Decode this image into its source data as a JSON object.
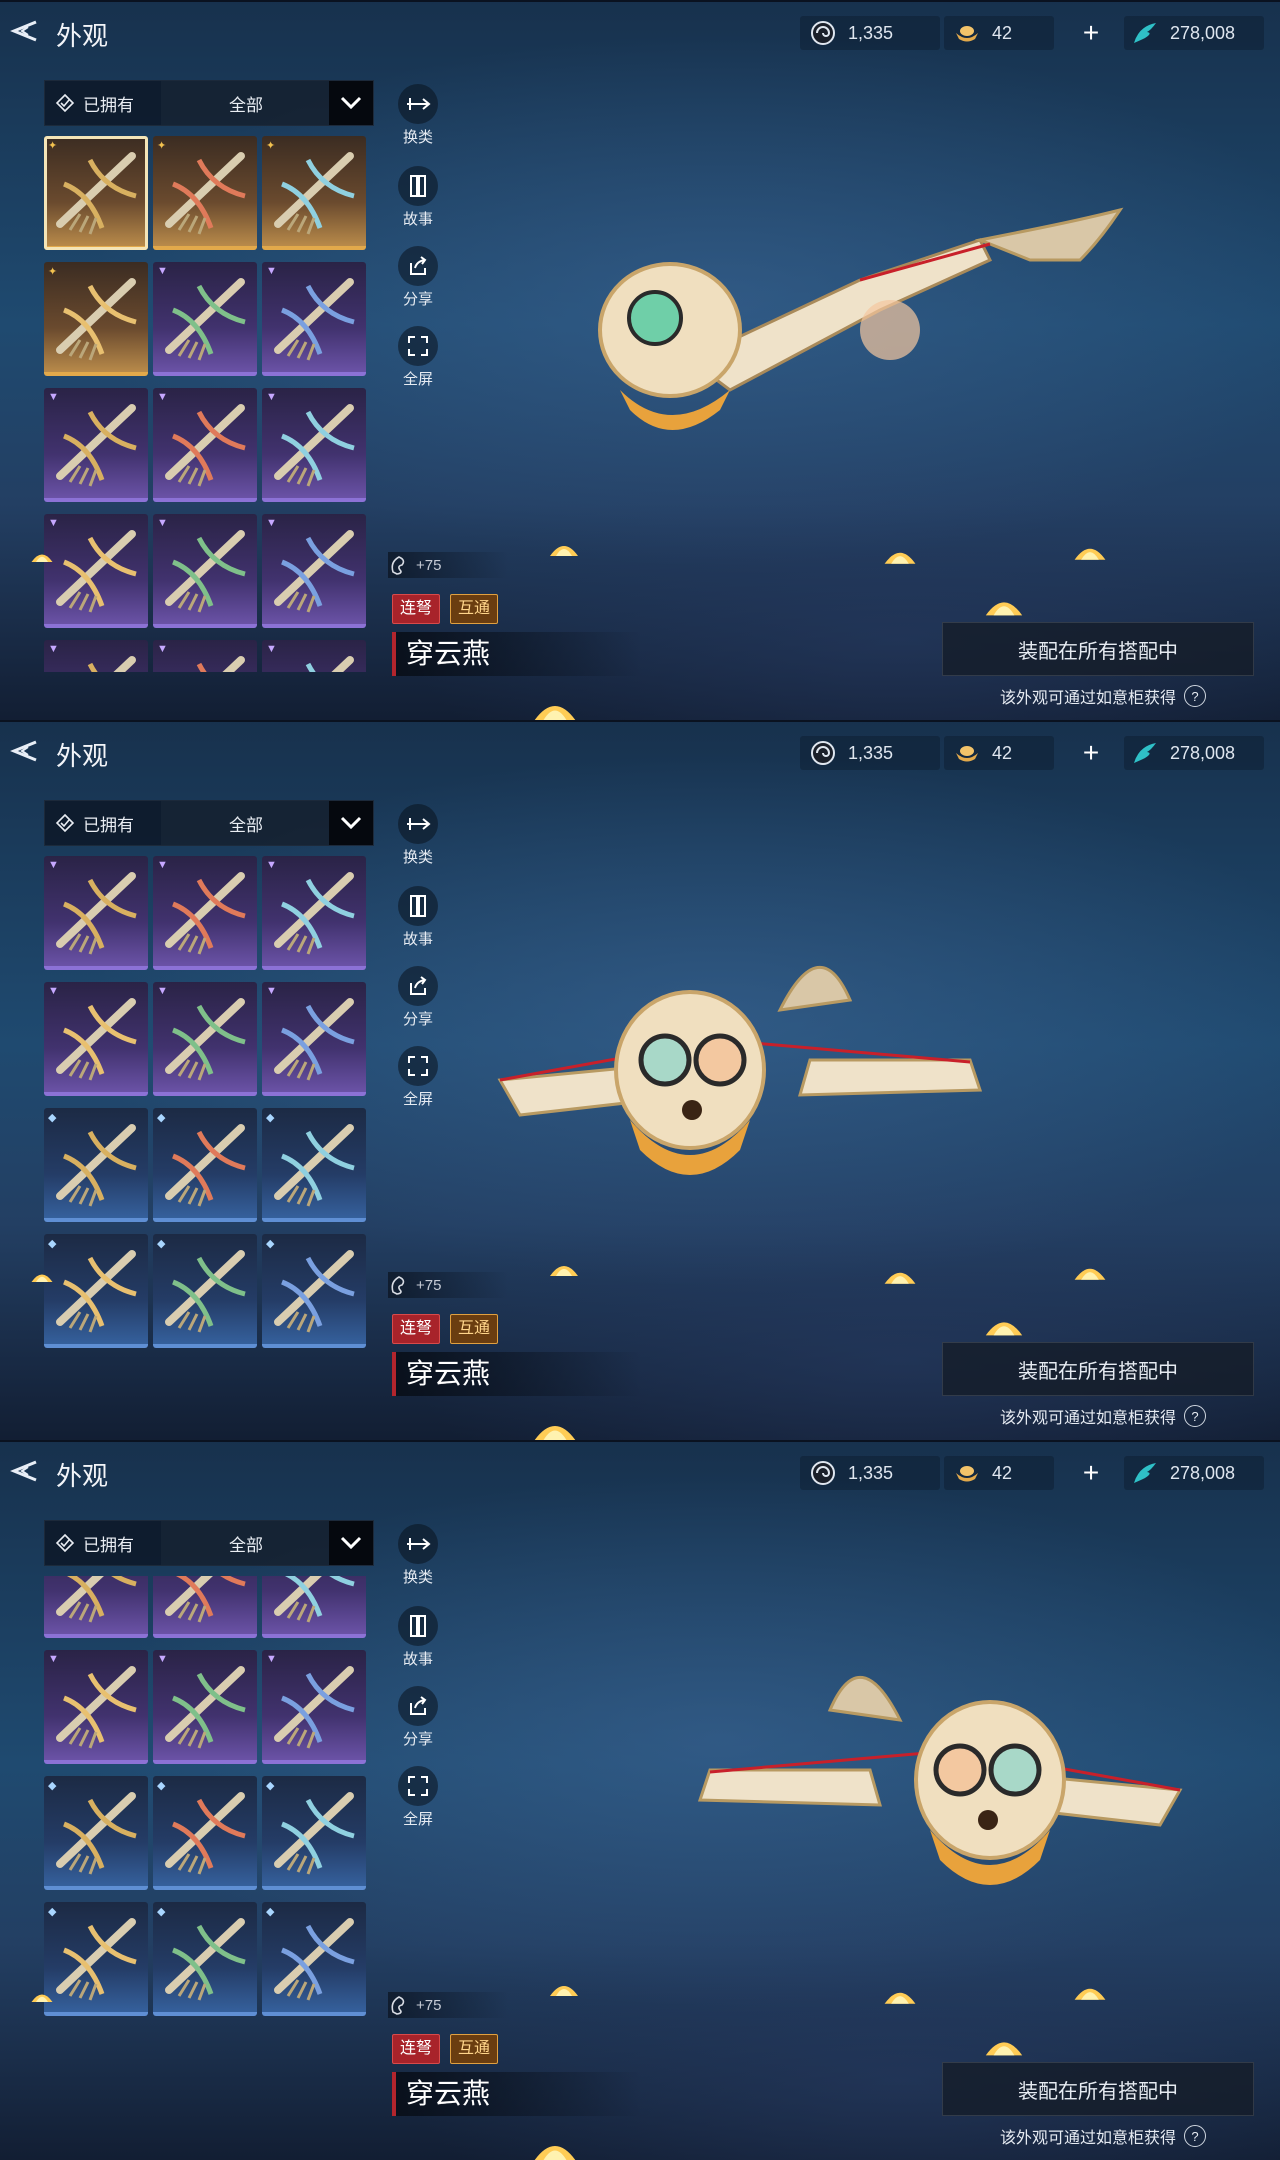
{
  "panels": [
    {
      "page_title": "外观",
      "currency": {
        "c1": "1,335",
        "c2": "42",
        "c3": "278,008"
      },
      "filter": {
        "owned_label": "已拥有",
        "category": "全部"
      },
      "actions": {
        "switch": "换类",
        "story": "故事",
        "share": "分享",
        "fullscreen": "全屏"
      },
      "power": "+75",
      "tags": [
        "连弩",
        "互通"
      ],
      "item_name": "穿云燕",
      "equip_button": "装配在所有搭配中",
      "source_hint": "该外观可通过如意柜获得",
      "help": "?"
    },
    {
      "page_title": "外观",
      "currency": {
        "c1": "1,335",
        "c2": "42",
        "c3": "278,008"
      },
      "filter": {
        "owned_label": "已拥有",
        "category": "全部"
      },
      "actions": {
        "switch": "换类",
        "story": "故事",
        "share": "分享",
        "fullscreen": "全屏"
      },
      "power": "+75",
      "tags": [
        "连弩",
        "互通"
      ],
      "item_name": "穿云燕",
      "equip_button": "装配在所有搭配中",
      "source_hint": "该外观可通过如意柜获得",
      "help": "?"
    },
    {
      "page_title": "外观",
      "currency": {
        "c1": "1,335",
        "c2": "42",
        "c3": "278,008"
      },
      "filter": {
        "owned_label": "已拥有",
        "category": "全部"
      },
      "actions": {
        "switch": "换类",
        "story": "故事",
        "share": "分享",
        "fullscreen": "全屏"
      },
      "power": "+75",
      "tags": [
        "连弩",
        "互通"
      ],
      "item_name": "穿云燕",
      "equip_button": "装配在所有搭配中",
      "source_hint": "该外观可通过如意柜获得",
      "help": "?"
    }
  ],
  "grids": [
    [
      "gold-sel",
      "gold",
      "gold",
      "gold",
      "purple",
      "purple",
      "purple",
      "purple",
      "purple",
      "purple",
      "purple",
      "purple",
      "purple",
      "purple",
      "purple"
    ],
    [
      "purple",
      "purple",
      "purple",
      "purple",
      "purple",
      "purple",
      "blue",
      "blue",
      "blue",
      "blue",
      "blue",
      "blue"
    ],
    [
      "purple",
      "purple",
      "purple",
      "purple",
      "purple",
      "purple",
      "blue",
      "blue",
      "blue",
      "blue",
      "blue",
      "blue"
    ]
  ],
  "colors": {
    "gold": "#e2a94b",
    "purple": "#8c72d6",
    "blue": "#5f8fd4",
    "tag_red": "#a8232a",
    "tag_amber": "#e0a040"
  }
}
